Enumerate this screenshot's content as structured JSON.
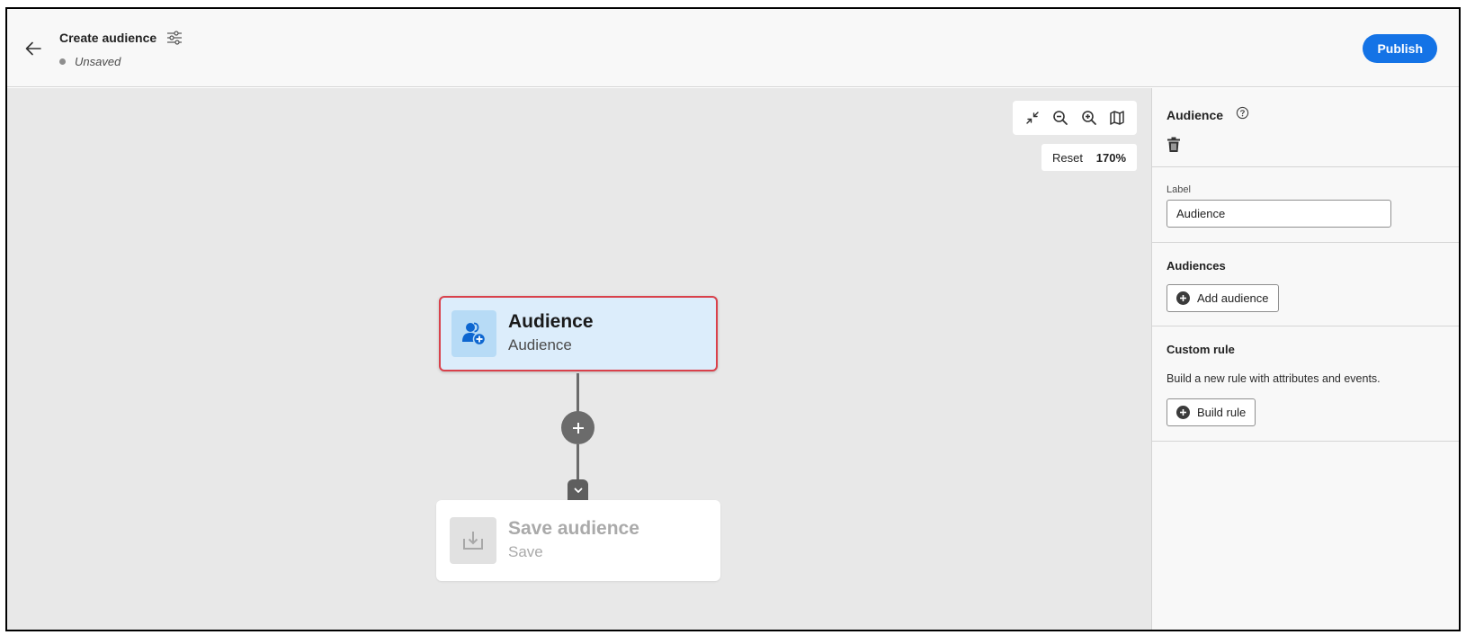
{
  "header": {
    "title": "Create audience",
    "status": "Unsaved",
    "publish_label": "Publish"
  },
  "canvas": {
    "zoom": {
      "reset_label": "Reset",
      "level": "170%"
    },
    "nodes": {
      "audience": {
        "title": "Audience",
        "subtitle": "Audience"
      },
      "save": {
        "title": "Save audience",
        "subtitle": "Save"
      }
    }
  },
  "panel": {
    "heading": "Audience",
    "label_field": {
      "label": "Label",
      "value": "Audience"
    },
    "audiences_section": {
      "title": "Audiences",
      "add_button": "Add audience"
    },
    "custom_rule_section": {
      "title": "Custom rule",
      "description": "Build a new rule with attributes and events.",
      "build_button": "Build rule"
    }
  },
  "colors": {
    "accent": "#1473e6",
    "selected_node_fill": "#dcedfb",
    "selected_node_border": "#d9414b",
    "audience_icon": "#0d66d0"
  },
  "icons": [
    "arrow-left-icon",
    "settings-sliders-icon",
    "help-icon",
    "collapse-icon",
    "zoom-out-icon",
    "zoom-in-icon",
    "map-icon",
    "trash-icon",
    "add-user-icon",
    "plus-icon",
    "chevron-down-icon",
    "download-icon"
  ]
}
